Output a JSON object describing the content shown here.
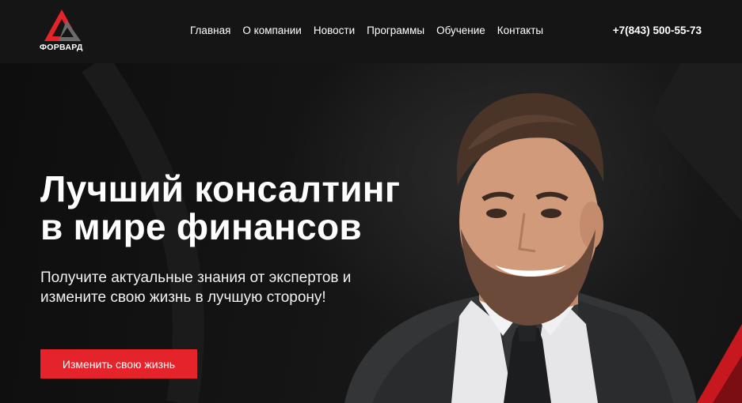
{
  "header": {
    "logo_text": "ФОРВАРД",
    "nav": [
      {
        "label": "Главная"
      },
      {
        "label": "О компании"
      },
      {
        "label": "Новости"
      },
      {
        "label": "Программы"
      },
      {
        "label": "Обучение"
      },
      {
        "label": "Контакты"
      }
    ],
    "phone": "+7(843) 500-55-73"
  },
  "hero": {
    "title_line1": "Лучший консалтинг",
    "title_line2": "в мире финансов",
    "subtitle_line1": "Получите актуальные знания от экспертов и",
    "subtitle_line2": "измените свою жизнь в лучшую сторону!",
    "cta_label": "Изменить свою жизнь"
  },
  "colors": {
    "accent": "#e4232a",
    "background": "#151515",
    "text": "#ffffff"
  },
  "icons": {
    "logo": "triangle-letter-a-logo"
  }
}
